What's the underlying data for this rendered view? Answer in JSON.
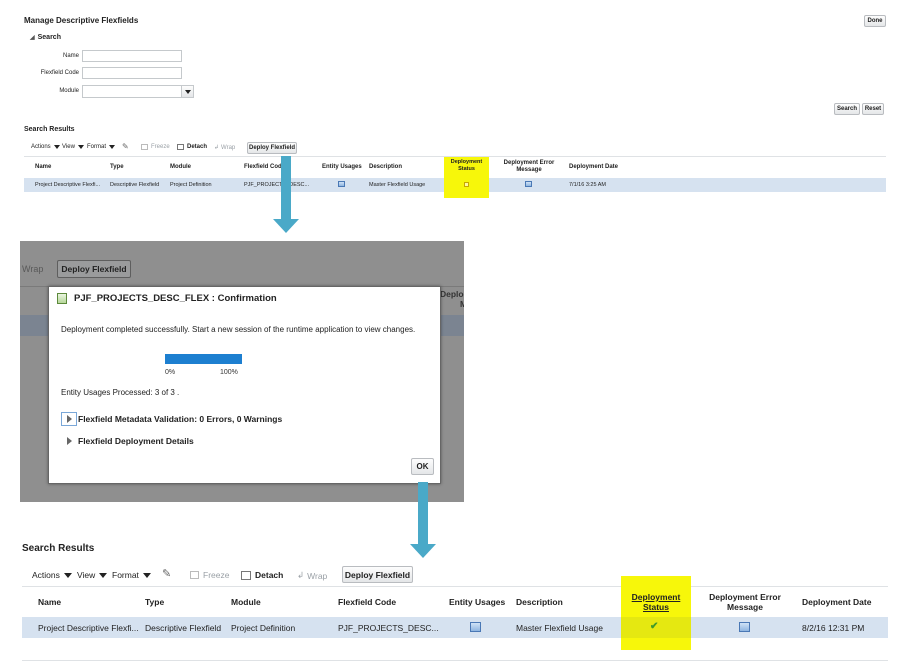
{
  "top": {
    "title": "Manage Descriptive Flexfields",
    "done_label": "Done",
    "search_heading": "Search",
    "fields": [
      {
        "label": "Name",
        "value": ""
      },
      {
        "label": "Flexfield Code",
        "value": ""
      },
      {
        "label": "Module",
        "value": ""
      }
    ],
    "search_button": "Search",
    "reset_button": "Reset",
    "results_title": "Search Results",
    "toolbar": {
      "actions": "Actions",
      "view": "View",
      "format": "Format",
      "freeze": "Freeze",
      "detach": "Detach",
      "wrap": "Wrap",
      "deploy": "Deploy Flexfield"
    },
    "columns": {
      "name": "Name",
      "type": "Type",
      "module": "Module",
      "code": "Flexfield Code",
      "entity_usages": "Entity Usages",
      "description": "Description",
      "status_l1": "Deployment",
      "status_l2": "Status",
      "error_l1": "Deployment Error",
      "error_l2": "Message",
      "date": "Deployment Date"
    },
    "row": {
      "name": "Project Descriptive Flexfi...",
      "type": "Descriptive Flexfield",
      "module": "Project Definition",
      "code": "PJF_PROJECTS_DESC...",
      "description": "Master Flexfield Usage",
      "date": "7/1/16 3:25 AM"
    }
  },
  "dialog": {
    "bg_wrap": "Wrap",
    "bg_deploy": "Deploy Flexfield",
    "bg_col_partial_1": "Deplo",
    "bg_col_partial_2": "M",
    "title": "PJF_PROJECTS_DESC_FLEX : Confirmation",
    "message": "Deployment completed successfully. Start a new session of the runtime application to view changes.",
    "progress": 1.0,
    "progress_min": "0%",
    "progress_max": "100%",
    "entity_processed": "Entity Usages Processed: 3 of 3 .",
    "section1": "Flexfield Metadata Validation: 0 Errors, 0 Warnings",
    "section2": "Flexfield Deployment Details",
    "ok_label": "OK"
  },
  "bottom": {
    "results_title": "Search Results",
    "toolbar": {
      "actions": "Actions",
      "view": "View",
      "format": "Format",
      "freeze": "Freeze",
      "detach": "Detach",
      "wrap": "Wrap",
      "deploy": "Deploy Flexfield"
    },
    "columns": {
      "name": "Name",
      "type": "Type",
      "module": "Module",
      "code": "Flexfield Code",
      "entity_usages": "Entity Usages",
      "description": "Description",
      "status_l1": "Deployment",
      "status_l2": "Status",
      "error_l1": "Deployment Error",
      "error_l2": "Message",
      "date": "Deployment Date"
    },
    "row": {
      "name": "Project Descriptive Flexfi...",
      "type": "Descriptive Flexfield",
      "module": "Project Definition",
      "code": "PJF_PROJECTS_DESC...",
      "description": "Master Flexfield Usage",
      "date": "8/2/16 12:31 PM"
    }
  },
  "colors": {
    "highlight": "#f7f70a",
    "arrow": "#4aa9c8",
    "row_selected": "#d6e2f0",
    "progress": "#1d7fd0",
    "check": "#3f9b2a"
  }
}
